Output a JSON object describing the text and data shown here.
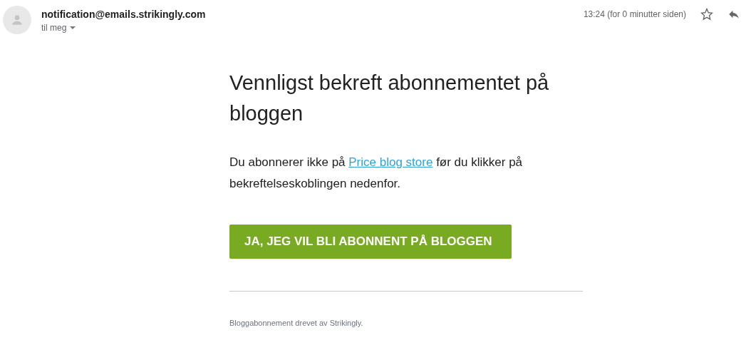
{
  "header": {
    "sender": "notification@emails.strikingly.com",
    "recipient": "til meg",
    "time": "13:24 (for 0 minutter siden)",
    "starred": false
  },
  "email": {
    "title": "Vennligst bekreft abonnementet på bloggen",
    "paragraph": {
      "before": "Du abonnerer ikke på ",
      "link": "Price blog store",
      "after": " før du klikker på bekreftelseskoblingen nedenfor."
    },
    "button": "JA, JEG VIL BLI ABONNENT PÅ BLOGGEN",
    "footer": "Bloggabonnement drevet av Strikingly."
  }
}
